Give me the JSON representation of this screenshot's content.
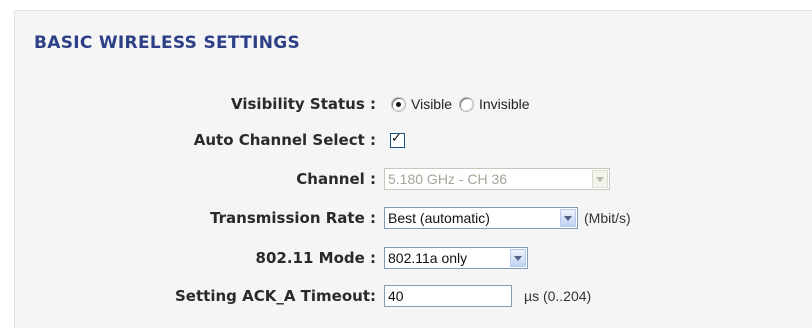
{
  "section": {
    "title": "BASIC WIRELESS SETTINGS"
  },
  "visibility": {
    "label": "Visibility Status :",
    "options": [
      {
        "label": "Visible",
        "selected": true
      },
      {
        "label": "Invisible",
        "selected": false
      }
    ]
  },
  "auto_channel": {
    "label": "Auto Channel Select :",
    "checked": true,
    "check_glyph": "✓"
  },
  "channel": {
    "label": "Channel :",
    "value": "5.180 GHz - CH 36",
    "disabled": true
  },
  "transmission_rate": {
    "label": "Transmission Rate :",
    "value": "Best (automatic)",
    "unit": "(Mbit/s)"
  },
  "mode": {
    "label": "802.11 Mode :",
    "value": "802.11a only"
  },
  "ack_timeout": {
    "label": "Setting ACK_A Timeout:",
    "value": "40",
    "unit": "µs (0..204)"
  },
  "colors": {
    "title": "#2c3f87",
    "panel_bg": "#f5f5f5",
    "input_border": "#7f9db9"
  }
}
